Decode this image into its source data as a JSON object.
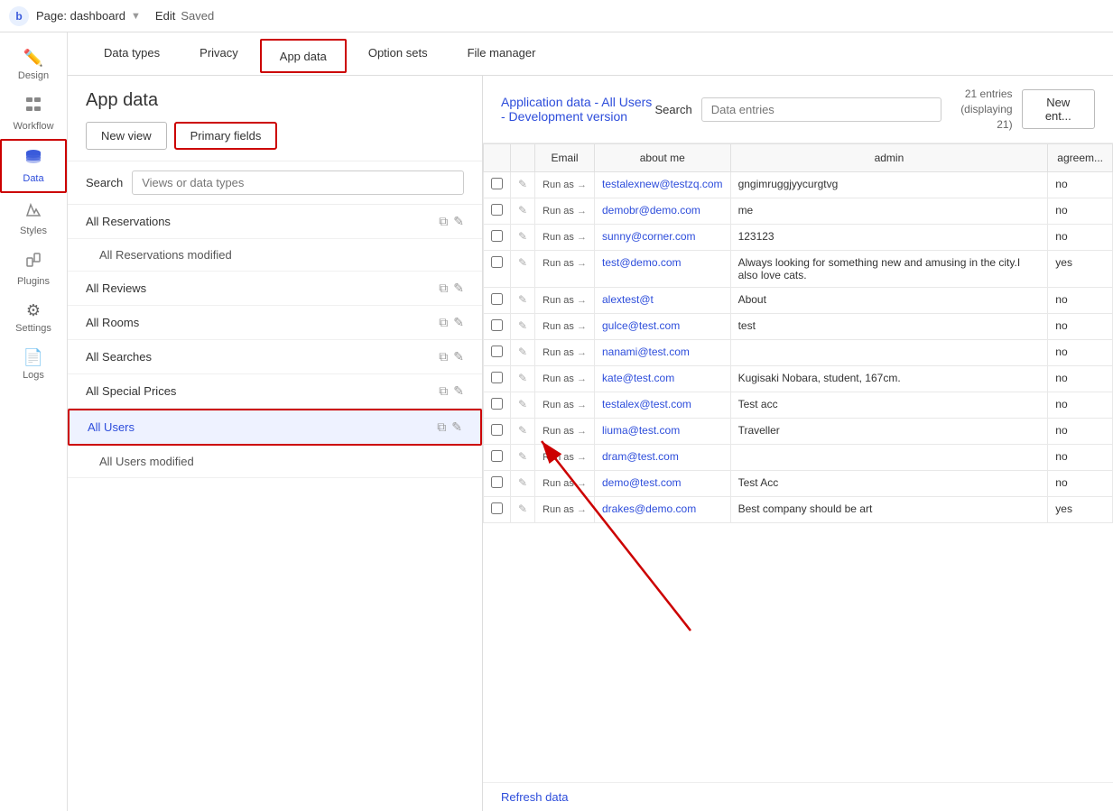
{
  "topbar": {
    "logo": "b",
    "page_label": "Page: dashboard",
    "arrow": "▼",
    "edit_label": "Edit",
    "saved_label": "Saved"
  },
  "sidebar": {
    "items": [
      {
        "id": "design",
        "label": "Design",
        "icon": "✏"
      },
      {
        "id": "workflow",
        "label": "Workflow",
        "icon": "⊞"
      },
      {
        "id": "data",
        "label": "Data",
        "icon": "🗄"
      },
      {
        "id": "styles",
        "label": "Styles",
        "icon": "✏"
      },
      {
        "id": "plugins",
        "label": "Plugins",
        "icon": "⚡"
      },
      {
        "id": "settings",
        "label": "Settings",
        "icon": "⚙"
      },
      {
        "id": "logs",
        "label": "Logs",
        "icon": "📄"
      }
    ]
  },
  "tabs": [
    {
      "id": "data-types",
      "label": "Data types"
    },
    {
      "id": "privacy",
      "label": "Privacy"
    },
    {
      "id": "app-data",
      "label": "App data",
      "active": true
    },
    {
      "id": "option-sets",
      "label": "Option sets"
    },
    {
      "id": "file-manager",
      "label": "File manager"
    }
  ],
  "app_data": {
    "title": "App data",
    "subtitle": "Application data - All Users - Development version",
    "new_view_label": "New view",
    "primary_fields_label": "Primary fields",
    "search_label": "Search",
    "views_placeholder": "Views or data types",
    "data_entries_placeholder": "Data entries",
    "entries_count": "21 entries",
    "entries_displaying": "(displaying 21)",
    "new_entry_label": "New ent...",
    "refresh_label": "Refresh data",
    "views": [
      {
        "id": "all-reservations",
        "label": "All Reservations",
        "sub": false,
        "has_icons": true
      },
      {
        "id": "all-reservations-modified",
        "label": "All Reservations modified",
        "sub": true,
        "has_icons": false
      },
      {
        "id": "all-reviews",
        "label": "All Reviews",
        "sub": false,
        "has_icons": true
      },
      {
        "id": "all-rooms",
        "label": "All Rooms",
        "sub": false,
        "has_icons": true
      },
      {
        "id": "all-searches",
        "label": "All Searches",
        "sub": false,
        "has_icons": true
      },
      {
        "id": "all-special-prices",
        "label": "All Special Prices",
        "sub": false,
        "has_icons": true
      },
      {
        "id": "all-users",
        "label": "All Users",
        "sub": false,
        "has_icons": true,
        "active": true
      },
      {
        "id": "all-users-modified",
        "label": "All Users modified",
        "sub": true,
        "has_icons": false
      }
    ],
    "table": {
      "columns": [
        "",
        "",
        "Email",
        "about me",
        "admin",
        "agreem..."
      ],
      "rows": [
        {
          "email": "testalexnew@testzq.com",
          "about_me": "gngimruggjyycurgtvg",
          "admin": "no",
          "agreement": ""
        },
        {
          "email": "demobr@demo.com",
          "about_me": "me",
          "admin": "no",
          "agreement": ""
        },
        {
          "email": "sunny@corner.com",
          "about_me": "123123",
          "admin": "no",
          "agreement": ""
        },
        {
          "email": "test@demo.com",
          "about_me": "Always looking for something new and amusing in the city.I also love cats.",
          "admin": "yes",
          "agreement": ""
        },
        {
          "email": "alextest@t",
          "about_me": "About",
          "admin": "no",
          "agreement": ""
        },
        {
          "email": "gulce@test.com",
          "about_me": "test",
          "admin": "no",
          "agreement": ""
        },
        {
          "email": "nanami@test.com",
          "about_me": "",
          "admin": "no",
          "agreement": ""
        },
        {
          "email": "kate@test.com",
          "about_me": "Kugisaki Nobara, student, 167cm.",
          "admin": "no",
          "agreement": ""
        },
        {
          "email": "testalex@test.com",
          "about_me": "Test acc",
          "admin": "no",
          "agreement": ""
        },
        {
          "email": "liuma@test.com",
          "about_me": "Traveller",
          "admin": "no",
          "agreement": ""
        },
        {
          "email": "dram@test.com",
          "about_me": "",
          "admin": "no",
          "agreement": ""
        },
        {
          "email": "demo@test.com",
          "about_me": "Test Acc",
          "admin": "no",
          "agreement": ""
        },
        {
          "email": "drakes@demo.com",
          "about_me": "Best company should be art",
          "admin": "yes",
          "agreement": ""
        }
      ]
    }
  }
}
